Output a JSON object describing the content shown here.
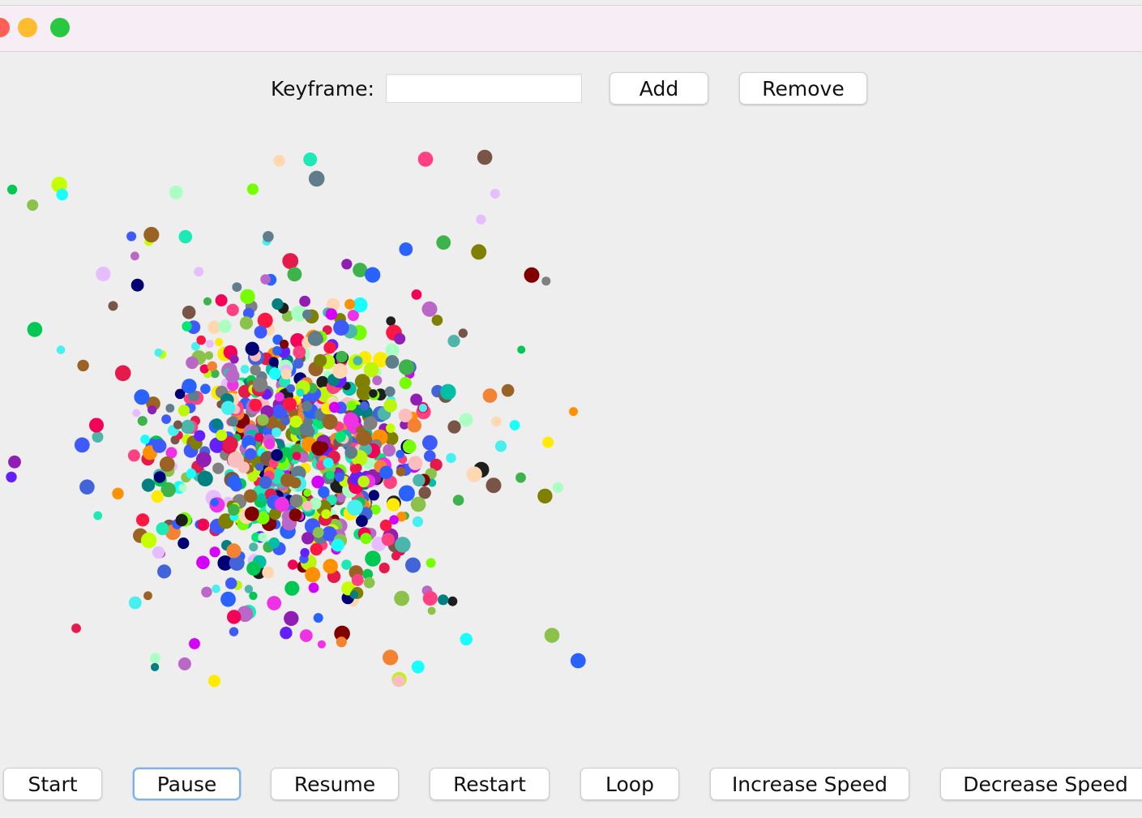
{
  "window": {
    "controls": [
      "close-button",
      "minimize-button",
      "maximize-button"
    ]
  },
  "keyframe": {
    "label": "Keyframe:",
    "value": "",
    "add_label": "Add",
    "remove_label": "Remove"
  },
  "controls": {
    "start_label": "Start",
    "pause_label": "Pause",
    "resume_label": "Resume",
    "restart_label": "Restart",
    "loop_label": "Loop",
    "increase_speed_label": "Increase Speed",
    "decrease_speed_label": "Decrease Speed",
    "focused": "pause"
  },
  "colors": {
    "window_bg": "#eeeeee",
    "titlebar_bg": "#f6eef4",
    "close": "#fe5f57",
    "minimize": "#febc2e",
    "maximize": "#28c840",
    "focus_ring": "#7fb2e6"
  },
  "particles": {
    "approx_count": 900,
    "palette": [
      "#e6194b",
      "#3cb44b",
      "#4363d8",
      "#f58231",
      "#911eb4",
      "#46f0f0",
      "#f032e6",
      "#bcf60c",
      "#fabebe",
      "#008080",
      "#e6beff",
      "#9a6324",
      "#800000",
      "#aaffc3",
      "#808000",
      "#ffd8b1",
      "#000075",
      "#808080",
      "#1e1e1e",
      "#00c853",
      "#2962ff",
      "#d500f9",
      "#00bfa5",
      "#ff1744",
      "#ffea00",
      "#76ff03",
      "#ff4081",
      "#18ffff",
      "#651fff",
      "#c6ff00",
      "#ff9100",
      "#1de9b6",
      "#3d5afe",
      "#f50057",
      "#00e676",
      "#795548",
      "#607d8b",
      "#8bc34a",
      "#ba68c8",
      "#4db6ac"
    ]
  }
}
